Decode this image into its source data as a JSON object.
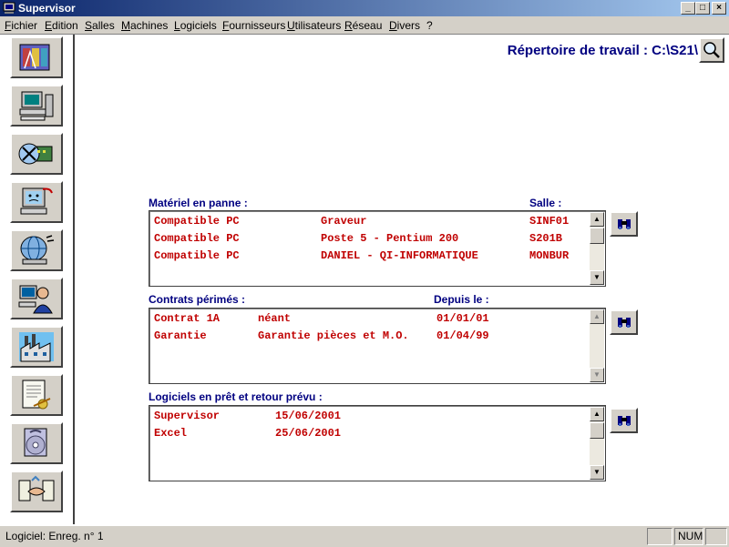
{
  "window": {
    "title": "Supervisor"
  },
  "menu": [
    "Fichier",
    "Edition",
    "Salles",
    "Machines",
    "Logiciels",
    "Fournisseurs",
    "Utilisateurs",
    "Réseau",
    "Divers",
    "?"
  ],
  "workdir": {
    "label": "Répertoire de travail : C:\\S21\\"
  },
  "toolbar": {
    "buttons": [
      "salles-icon",
      "machines-icon",
      "logiciels-icon",
      "maintenance-icon",
      "reseau-icon",
      "utilisateurs-icon",
      "usine-icon",
      "contrats-icon",
      "cd-icon",
      "fournisseurs-icon"
    ]
  },
  "materiel": {
    "label": "Matériel en panne :",
    "col_salle": "Salle :",
    "rows": [
      {
        "type": "Compatible PC",
        "desc": "Graveur",
        "salle": "SINF01"
      },
      {
        "type": "Compatible PC",
        "desc": "Poste 5 - Pentium 200",
        "salle": "S201B"
      },
      {
        "type": "Compatible PC",
        "desc": "DANIEL - QI-INFORMATIQUE",
        "salle": "MONBUR"
      }
    ]
  },
  "contrats": {
    "label": "Contrats périmés :",
    "col_depuis": "Depuis le :",
    "rows": [
      {
        "name": "Contrat 1A",
        "desc": "néant",
        "date": "01/01/01"
      },
      {
        "name": "Garantie",
        "desc": "Garantie pièces et M.O.",
        "date": "01/04/99"
      }
    ]
  },
  "logiciels": {
    "label": "Logiciels en prêt et retour prévu :",
    "rows": [
      {
        "name": "Supervisor",
        "date": "15/06/2001"
      },
      {
        "name": "Excel",
        "date": "25/06/2001"
      }
    ]
  },
  "status": {
    "text": "Logiciel: Enreg. n° 1",
    "num": "NUM"
  },
  "colors": {
    "accent": "#000080",
    "row_text": "#c00000",
    "chrome": "#d4d0c8"
  }
}
